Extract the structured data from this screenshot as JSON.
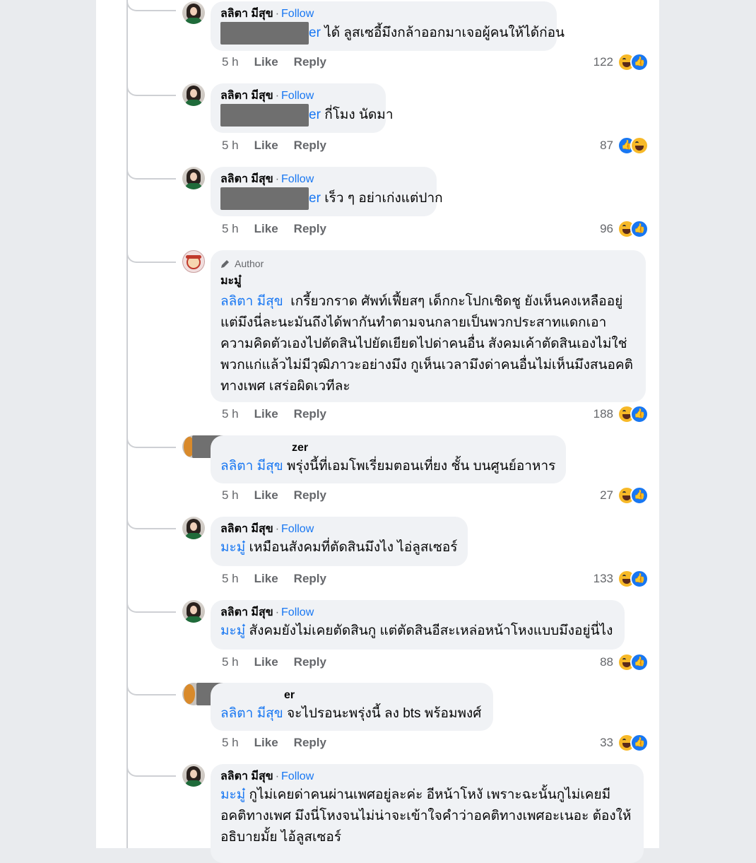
{
  "follow_label": "Follow",
  "like_label": "Like",
  "reply_label": "Reply",
  "author_badge": "Author",
  "comments": [
    {
      "name": "ลลิตา มีสุข",
      "mention_suffix": "er",
      "text": "ได้ ลูสเซอี้มึงกล้าออกมาเจอผู้คนให้ได้ก่อน",
      "time": "5 h",
      "count": "122"
    },
    {
      "name": "ลลิตา มีสุข",
      "mention_suffix": "er",
      "text": "กี่โมง นัดมา",
      "time": "5 h",
      "count": "87"
    },
    {
      "name": "ลลิตา มีสุข",
      "mention_suffix": "er",
      "text": "เร็ว ๆ อย่าเก่งแต่ปาก",
      "time": "5 h",
      "count": "96"
    },
    {
      "name": "มะมู๋",
      "mention": "ลลิตา มีสุข",
      "text": "เกรี้ยวกราด ศัพท์เฟี้ยสๆ เด็กกะโปกเชิดชู ยังเห็นคงเหลืออยู่ แต่มึงนี่ละนะมันถึงได้พากันทำตามจนกลายเป็นพวกประสาทแดกเอาความคิดตัวเองไปตัดสินไปยัดเยียดไปด่าคนอื่น สังคมเค้าตัดสินเองไม่ใช่พวกแก่แล้วไม่มีวุฒิภาวะอย่างมึง กูเห็นเวลามึงด่าคนอื่นไม่เห็นมึงสนอคติทางเพศ เสร่อผิดเวทีละ",
      "time": "5 h",
      "count": "188"
    },
    {
      "name_suffix": "zer",
      "mention": "ลลิตา มีสุข",
      "text": "พรุ่งนี้ที่เอมโพเรี่ยมตอนเที่ยง ชั้น บนศูนย์อาหาร",
      "time": "5 h",
      "count": "27"
    },
    {
      "name": "ลลิตา มีสุข",
      "mention": "มะมู๋",
      "text": "เหมือนสังคมที่ตัดสินมึงไง ไอ่ลูสเซอร์",
      "time": "5 h",
      "count": "133"
    },
    {
      "name": "ลลิตา มีสุข",
      "mention": "มะมู๋",
      "text": "สังคมยังไม่เคยตัดสินกู แต่ตัดสินอีสะเหล่อหน้าโหงแบบมึงอยู่นี่ไง",
      "time": "5 h",
      "count": "88"
    },
    {
      "name_suffix": "er",
      "mention": "ลลิตา มีสุข",
      "text": "จะไปรอนะพรุ่งนี้ ลง bts พร้อมพงศ์",
      "time": "5 h",
      "count": "33"
    },
    {
      "name": "ลลิตา มีสุข",
      "mention": "มะมู๋",
      "text": "กูไม่เคยด่าคนผ่านเพศอยู่ละค่ะ อีหน้าโหงั เพราะฉะนั้นกูไม่เคยมีอคติทางเพศ มึงนี่โหงจนไม่น่าจะเข้าใจคำว่าอคติทางเพศอะเนอะ ต้องให้อธิบายมั้ย ไอ้ลูสเซอร์"
    }
  ]
}
